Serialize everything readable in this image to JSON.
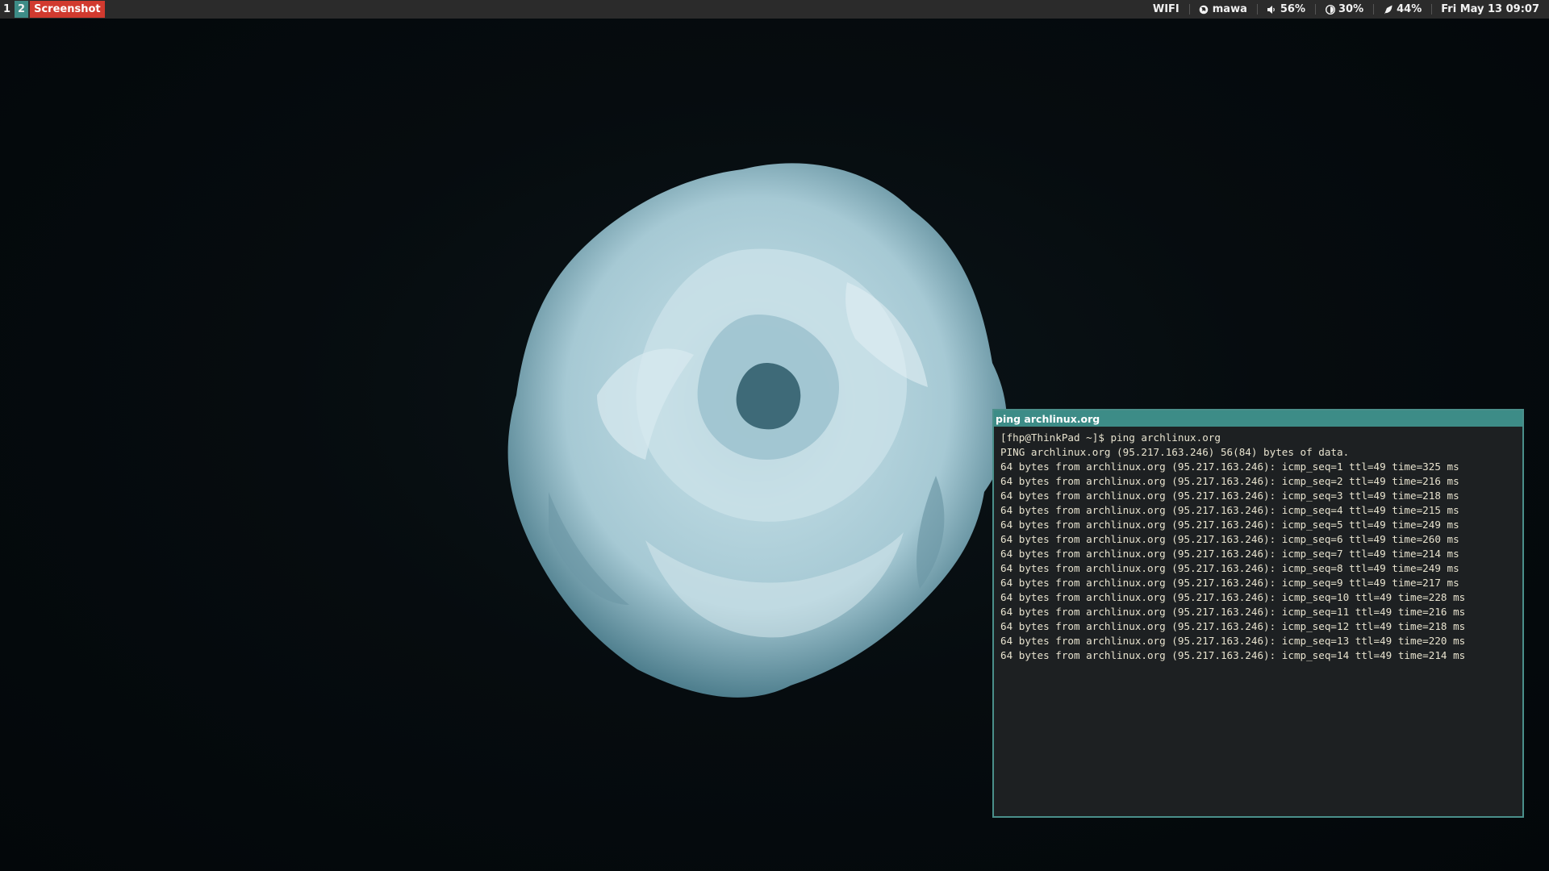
{
  "topbar": {
    "workspaces": [
      {
        "label": "1",
        "active": false
      },
      {
        "label": "2",
        "active": true
      }
    ],
    "window_title": "Screenshot",
    "status": {
      "wifi": "WIFI",
      "network": "mawa",
      "volume": "56%",
      "brightness": "30%",
      "battery": "44%",
      "datetime": "Fri May 13 09:07"
    },
    "icons": {
      "network": "globe-icon",
      "volume": "speaker-icon",
      "brightness": "brightness-icon",
      "battery": "battery-charging-icon"
    }
  },
  "terminal": {
    "title": "ping archlinux.org",
    "lines": [
      "[fhp@ThinkPad ~]$ ping archlinux.org",
      "PING archlinux.org (95.217.163.246) 56(84) bytes of data.",
      "64 bytes from archlinux.org (95.217.163.246): icmp_seq=1 ttl=49 time=325 ms",
      "64 bytes from archlinux.org (95.217.163.246): icmp_seq=2 ttl=49 time=216 ms",
      "64 bytes from archlinux.org (95.217.163.246): icmp_seq=3 ttl=49 time=218 ms",
      "64 bytes from archlinux.org (95.217.163.246): icmp_seq=4 ttl=49 time=215 ms",
      "64 bytes from archlinux.org (95.217.163.246): icmp_seq=5 ttl=49 time=249 ms",
      "64 bytes from archlinux.org (95.217.163.246): icmp_seq=6 ttl=49 time=260 ms",
      "64 bytes from archlinux.org (95.217.163.246): icmp_seq=7 ttl=49 time=214 ms",
      "64 bytes from archlinux.org (95.217.163.246): icmp_seq=8 ttl=49 time=249 ms",
      "64 bytes from archlinux.org (95.217.163.246): icmp_seq=9 ttl=49 time=217 ms",
      "64 bytes from archlinux.org (95.217.163.246): icmp_seq=10 ttl=49 time=228 ms",
      "64 bytes from archlinux.org (95.217.163.246): icmp_seq=11 ttl=49 time=216 ms",
      "64 bytes from archlinux.org (95.217.163.246): icmp_seq=12 ttl=49 time=218 ms",
      "64 bytes from archlinux.org (95.217.163.246): icmp_seq=13 ttl=49 time=220 ms",
      "64 bytes from archlinux.org (95.217.163.246): icmp_seq=14 ttl=49 time=214 ms"
    ]
  },
  "colors": {
    "bar_bg": "#2b2b2b",
    "workspace_active": "#3d8c87",
    "window_title_bg": "#d13a2f",
    "terminal_bg": "#1d2022",
    "terminal_fg": "#e8e3cf",
    "terminal_border": "#4a8f8a",
    "wallpaper_bg": "#050a0d"
  }
}
